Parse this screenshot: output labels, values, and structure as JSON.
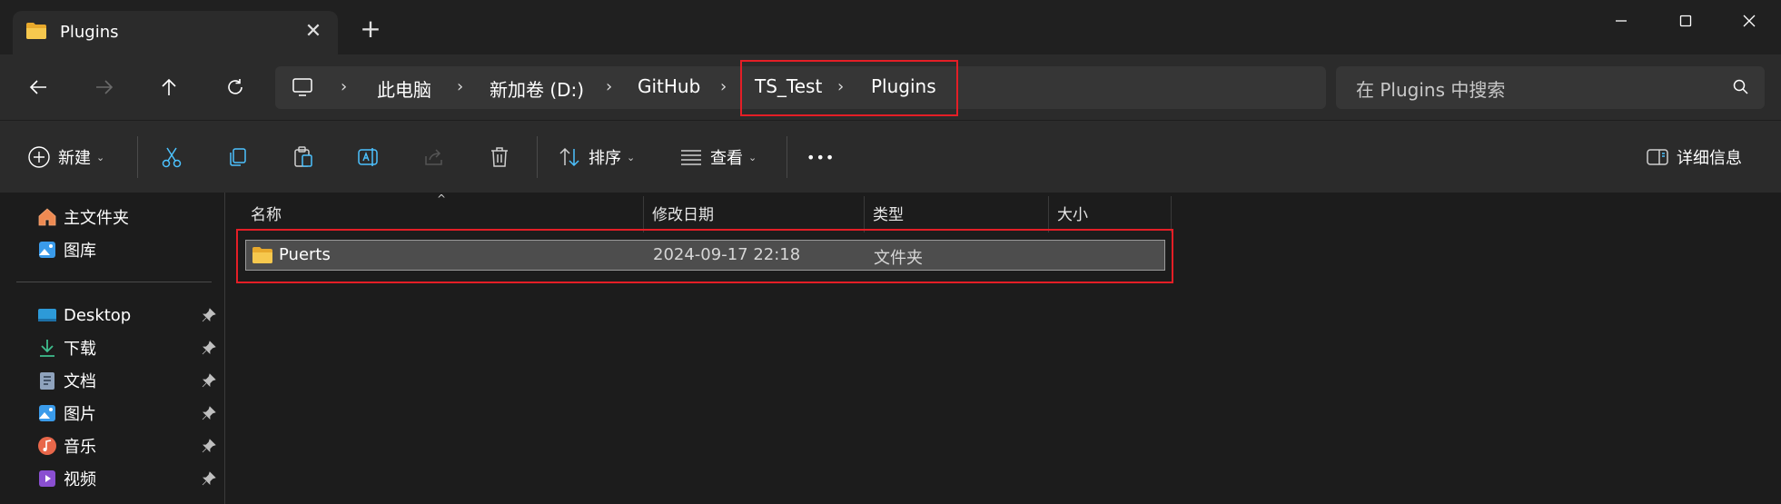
{
  "window": {
    "tab_title": "Plugins",
    "tab_close": "✕",
    "new_tab": "+"
  },
  "nav": {
    "breadcrumbs": [
      "此电脑",
      "新加卷 (D:)",
      "GitHub",
      "TS_Test",
      "Plugins"
    ],
    "search_placeholder": "在 Plugins 中搜索"
  },
  "toolbar": {
    "new_label": "新建",
    "sort_label": "排序",
    "view_label": "查看",
    "details_label": "详细信息",
    "more_label": "•••"
  },
  "sidebar": {
    "quick": [
      {
        "label": "主文件夹",
        "icon": "home-icon"
      },
      {
        "label": "图库",
        "icon": "gallery-icon"
      }
    ],
    "pinned": [
      {
        "label": "Desktop",
        "icon": "desktop-icon"
      },
      {
        "label": "下载",
        "icon": "download-icon"
      },
      {
        "label": "文档",
        "icon": "documents-icon"
      },
      {
        "label": "图片",
        "icon": "pictures-icon"
      },
      {
        "label": "音乐",
        "icon": "music-icon"
      },
      {
        "label": "视频",
        "icon": "videos-icon"
      }
    ]
  },
  "list": {
    "columns": [
      "名称",
      "修改日期",
      "类型",
      "大小"
    ],
    "rows": [
      {
        "name": "Puerts",
        "modified": "2024-09-17 22:18",
        "type": "文件夹",
        "size": ""
      }
    ]
  },
  "colors": {
    "highlight": "#e41e26",
    "accent": "#4cc2ff",
    "folder": "#f2c14e"
  }
}
